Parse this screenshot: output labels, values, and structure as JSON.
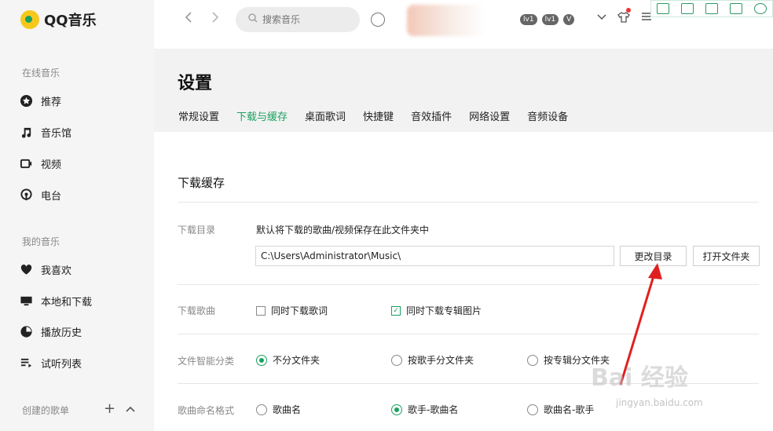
{
  "app": {
    "name": "QQ音乐"
  },
  "sidebar": {
    "online_label": "在线音乐",
    "online_items": [
      {
        "label": "推荐",
        "icon": "star-icon"
      },
      {
        "label": "音乐馆",
        "icon": "music-note-icon"
      },
      {
        "label": "视频",
        "icon": "video-icon"
      },
      {
        "label": "电台",
        "icon": "radio-icon"
      }
    ],
    "mine_label": "我的音乐",
    "mine_items": [
      {
        "label": "我喜欢",
        "icon": "heart-icon"
      },
      {
        "label": "本地和下载",
        "icon": "monitor-icon"
      },
      {
        "label": "播放历史",
        "icon": "history-icon"
      },
      {
        "label": "试听列表",
        "icon": "playlist-icon"
      }
    ],
    "created_label": "创建的歌单",
    "add_symbol": "+",
    "collapse_symbol": "^"
  },
  "topbar": {
    "search_placeholder": "搜索音乐",
    "badges": [
      "lv1",
      "lv1"
    ]
  },
  "settings": {
    "title": "设置",
    "tabs": [
      "常规设置",
      "下载与缓存",
      "桌面歌词",
      "快捷键",
      "音效插件",
      "网络设置",
      "音频设备"
    ],
    "active_tab": "下载与缓存",
    "section_title": "下载缓存",
    "download_dir": {
      "label": "下载目录",
      "description": "默认将下载的歌曲/视频保存在此文件夹中",
      "path": "C:\\Users\\Administrator\\Music\\",
      "change_button": "更改目录",
      "open_button": "打开文件夹"
    },
    "download_songs": {
      "label": "下载歌曲",
      "option_lyrics": "同时下载歌词",
      "option_lyrics_checked": false,
      "option_cover": "同时下载专辑图片",
      "option_cover_checked": true
    },
    "smart_folder": {
      "label": "文件智能分类",
      "options": [
        "不分文件夹",
        "按歌手分文件夹",
        "按专辑分文件夹"
      ],
      "selected": "不分文件夹"
    },
    "naming": {
      "label": "歌曲命名格式",
      "options": [
        "歌曲名",
        "歌手-歌曲名",
        "歌曲名-歌手"
      ],
      "selected": "歌手-歌曲名"
    }
  },
  "watermark": {
    "text": "Bai 经验",
    "url": "jingyan.baidu.com"
  },
  "colors": {
    "accent": "#19a15f",
    "annotation": "#e02020"
  }
}
